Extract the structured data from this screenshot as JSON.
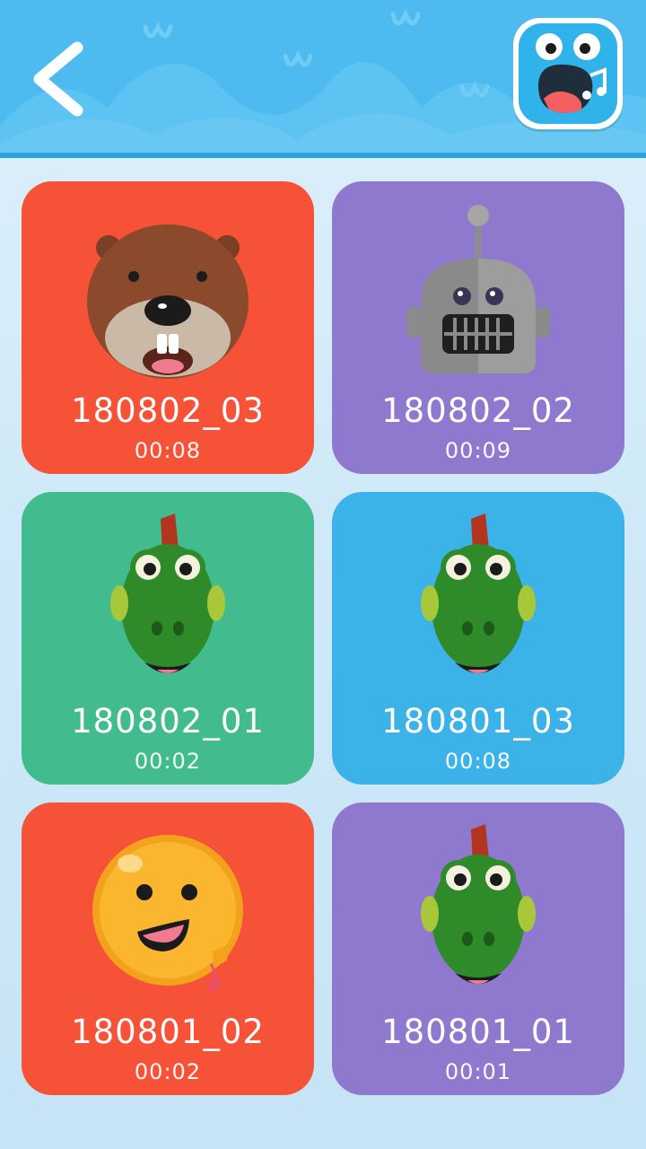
{
  "header": {
    "back_icon": "chevron-left-icon",
    "logo_icon": "singing-face-logo-icon",
    "background_color": "#4dbbef"
  },
  "recordings": [
    {
      "title": "180802_03",
      "duration": "00:08",
      "character": "beaver",
      "card_color": "#f55237"
    },
    {
      "title": "180802_02",
      "duration": "00:09",
      "character": "robot",
      "card_color": "#8e79cf"
    },
    {
      "title": "180802_01",
      "duration": "00:02",
      "character": "dinosaur",
      "card_color": "#42bb8f"
    },
    {
      "title": "180801_03",
      "duration": "00:08",
      "character": "dinosaur",
      "card_color": "#3cb3e8"
    },
    {
      "title": "180801_02",
      "duration": "00:02",
      "character": "sun",
      "card_color": "#f55237"
    },
    {
      "title": "180801_01",
      "duration": "00:01",
      "character": "dinosaur",
      "card_color": "#8e79cf"
    }
  ]
}
